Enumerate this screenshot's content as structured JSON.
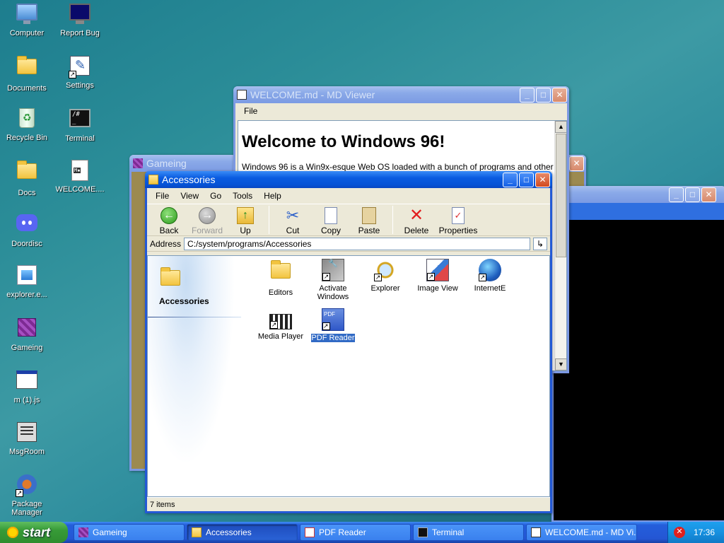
{
  "desktop": {
    "icons": [
      {
        "label": "Computer",
        "icon": "computer-icon"
      },
      {
        "label": "Report Bug",
        "icon": "report-bug-icon"
      },
      {
        "label": "Documents",
        "icon": "documents-icon"
      },
      {
        "label": "Settings",
        "icon": "settings-icon"
      },
      {
        "label": "Recycle Bin",
        "icon": "recycle-bin-icon"
      },
      {
        "label": "Terminal",
        "icon": "terminal-icon"
      },
      {
        "label": "Docs",
        "icon": "folder-icon"
      },
      {
        "label": "WELCOME....",
        "icon": "markdown-file-icon"
      },
      {
        "label": "Doordisc",
        "icon": "doordisc-icon"
      },
      {
        "label": "explorer.e...",
        "icon": "explorer-icon"
      },
      {
        "label": "Gameing",
        "icon": "gameing-cube-icon"
      },
      {
        "label": "m (1).js",
        "icon": "js-file-icon"
      },
      {
        "label": "MsgRoom",
        "icon": "msgroom-icon"
      },
      {
        "label": "Package Manager",
        "icon": "package-manager-icon"
      }
    ]
  },
  "gameing_window": {
    "title": "Gameing"
  },
  "md_viewer": {
    "title": "WELCOME.md - MD Viewer",
    "menu": [
      "File"
    ],
    "heading": "Welcome to Windows 96!",
    "paragraph": "Windows 96 is a Win9x-esque Web OS loaded with a bunch of programs and other"
  },
  "explorer": {
    "title": "Accessories",
    "menu": [
      "File",
      "View",
      "Go",
      "Tools",
      "Help"
    ],
    "toolbar": {
      "back": "Back",
      "forward": "Forward",
      "up": "Up",
      "cut": "Cut",
      "copy": "Copy",
      "paste": "Paste",
      "delete": "Delete",
      "properties": "Properties"
    },
    "address_label": "Address",
    "address_value": "C:/system/programs/Accessories",
    "address_go": "↳",
    "left_pane_title": "Accessories",
    "files": [
      {
        "label": "Editors",
        "icon": "folder-icon"
      },
      {
        "label": "Activate Windows",
        "icon": "activate-windows-icon"
      },
      {
        "label": "Explorer",
        "icon": "explorer-search-icon"
      },
      {
        "label": "Image View",
        "icon": "image-view-icon"
      },
      {
        "label": "InternetE",
        "icon": "globe-icon"
      },
      {
        "label": "Media Player",
        "icon": "media-player-icon"
      },
      {
        "label": "PDF Reader",
        "icon": "pdf-reader-icon",
        "selected": true
      }
    ],
    "status": "7 items"
  },
  "taskbar": {
    "start": "start",
    "tasks": [
      {
        "label": "Gameing",
        "active": false
      },
      {
        "label": "Accessories",
        "active": true
      },
      {
        "label": "PDF Reader",
        "active": false
      },
      {
        "label": "Terminal",
        "active": false
      },
      {
        "label": "WELCOME.md - MD Vi...",
        "active": false
      }
    ],
    "clock": "17:36"
  },
  "colors": {
    "titlebar_active": "#0a5be0",
    "titlebar_inactive": "#8aa9e8",
    "taskbar": "#245edb",
    "start_green": "#379b37",
    "selection": "#316ac5"
  }
}
